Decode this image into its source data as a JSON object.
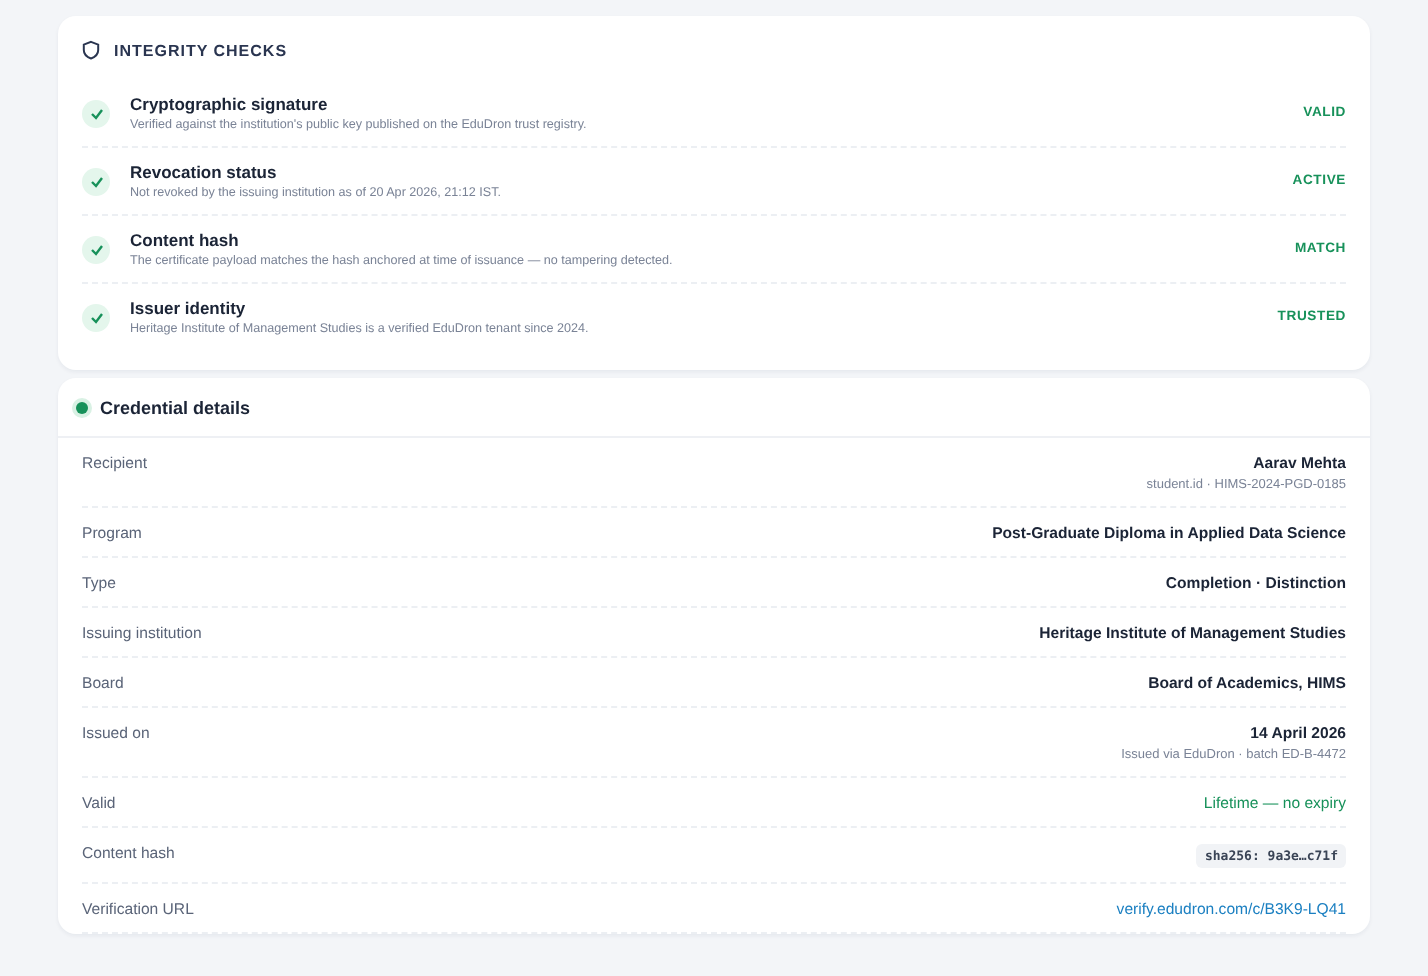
{
  "integrity_checks": {
    "title": "INTEGRITY CHECKS",
    "items": [
      {
        "title": "Cryptographic signature",
        "description": "Verified against the institution's public key published on the EduDron trust registry.",
        "status": "VALID",
        "passed": true
      },
      {
        "title": "Revocation status",
        "description": "Not revoked by the issuing institution as of 20 Apr 2026, 21:12 IST.",
        "status": "ACTIVE",
        "passed": true
      },
      {
        "title": "Content hash",
        "description": "The certificate payload matches the hash anchored at time of issuance — no tampering detected.",
        "status": "MATCH",
        "passed": true
      },
      {
        "title": "Issuer identity",
        "description": "Heritage Institute of Management Studies is a verified EduDron tenant since 2024.",
        "status": "TRUSTED",
        "passed": true
      }
    ]
  },
  "credential_details": {
    "title": "Credential details",
    "rows": [
      {
        "label": "Recipient",
        "kind": "text",
        "value": "Aarav Mehta",
        "sub": "student.id · HIMS-2024-PGD-0185"
      },
      {
        "label": "Program",
        "kind": "text",
        "value": "Post-Graduate Diploma in Applied Data Science"
      },
      {
        "label": "Type",
        "kind": "text",
        "value": "Completion · Distinction"
      },
      {
        "label": "Issuing institution",
        "kind": "text",
        "value": "Heritage Institute of Management Studies"
      },
      {
        "label": "Board",
        "kind": "text",
        "value": "Board of Academics, HIMS"
      },
      {
        "label": "Issued on",
        "kind": "text",
        "value": "14 April 2026",
        "sub": "Issued via EduDron · batch ED-B-4472"
      },
      {
        "label": "Valid",
        "kind": "success",
        "value": "Lifetime — no expiry"
      },
      {
        "label": "Content hash",
        "kind": "code",
        "value": "sha256: 9a3e…c71f"
      },
      {
        "label": "Verification URL",
        "kind": "link",
        "value": "verify.edudron.com/c/B3K9-LQ41"
      }
    ]
  }
}
